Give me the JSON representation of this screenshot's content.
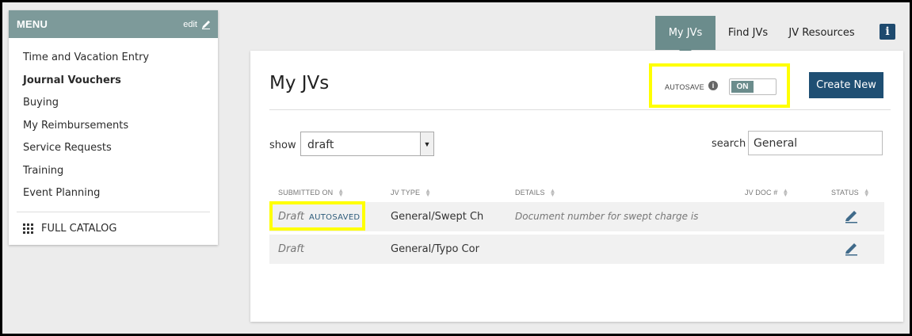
{
  "sidebar": {
    "title": "MENU",
    "edit_label": "edit",
    "items": [
      {
        "label": "Time and Vacation Entry",
        "active": false
      },
      {
        "label": "Journal Vouchers",
        "active": true
      },
      {
        "label": "Buying",
        "active": false
      },
      {
        "label": "My Reimbursements",
        "active": false
      },
      {
        "label": "Service Requests",
        "active": false
      },
      {
        "label": "Training",
        "active": false
      },
      {
        "label": "Event Planning",
        "active": false
      }
    ],
    "catalog_label": "FULL CATALOG"
  },
  "tabs": [
    {
      "label": "My JVs",
      "active": true
    },
    {
      "label": "Find JVs",
      "active": false
    },
    {
      "label": "JV Resources",
      "active": false
    }
  ],
  "info_icon_label": "i",
  "main": {
    "title": "My JVs",
    "autosave": {
      "label": "AUTOSAVE",
      "state": "ON"
    },
    "create_button": "Create New",
    "show_label": "show",
    "show_value": "draft",
    "search_label": "search",
    "search_value": "General"
  },
  "table": {
    "columns": [
      "SUBMITTED ON",
      "JV TYPE",
      "DETAILS",
      "JV DOC #",
      "STATUS"
    ],
    "rows": [
      {
        "submitted": "Draft",
        "tag": "AUTOSAVED",
        "type": "General/Swept Ch",
        "details": "Document number for swept charge is"
      },
      {
        "submitted": "Draft",
        "tag": "",
        "type": "General/Typo Cor",
        "details": ""
      }
    ]
  },
  "colors": {
    "accent_teal": "#6b8c8c",
    "primary_button": "#1f4f73",
    "highlight": "#ffff00"
  }
}
